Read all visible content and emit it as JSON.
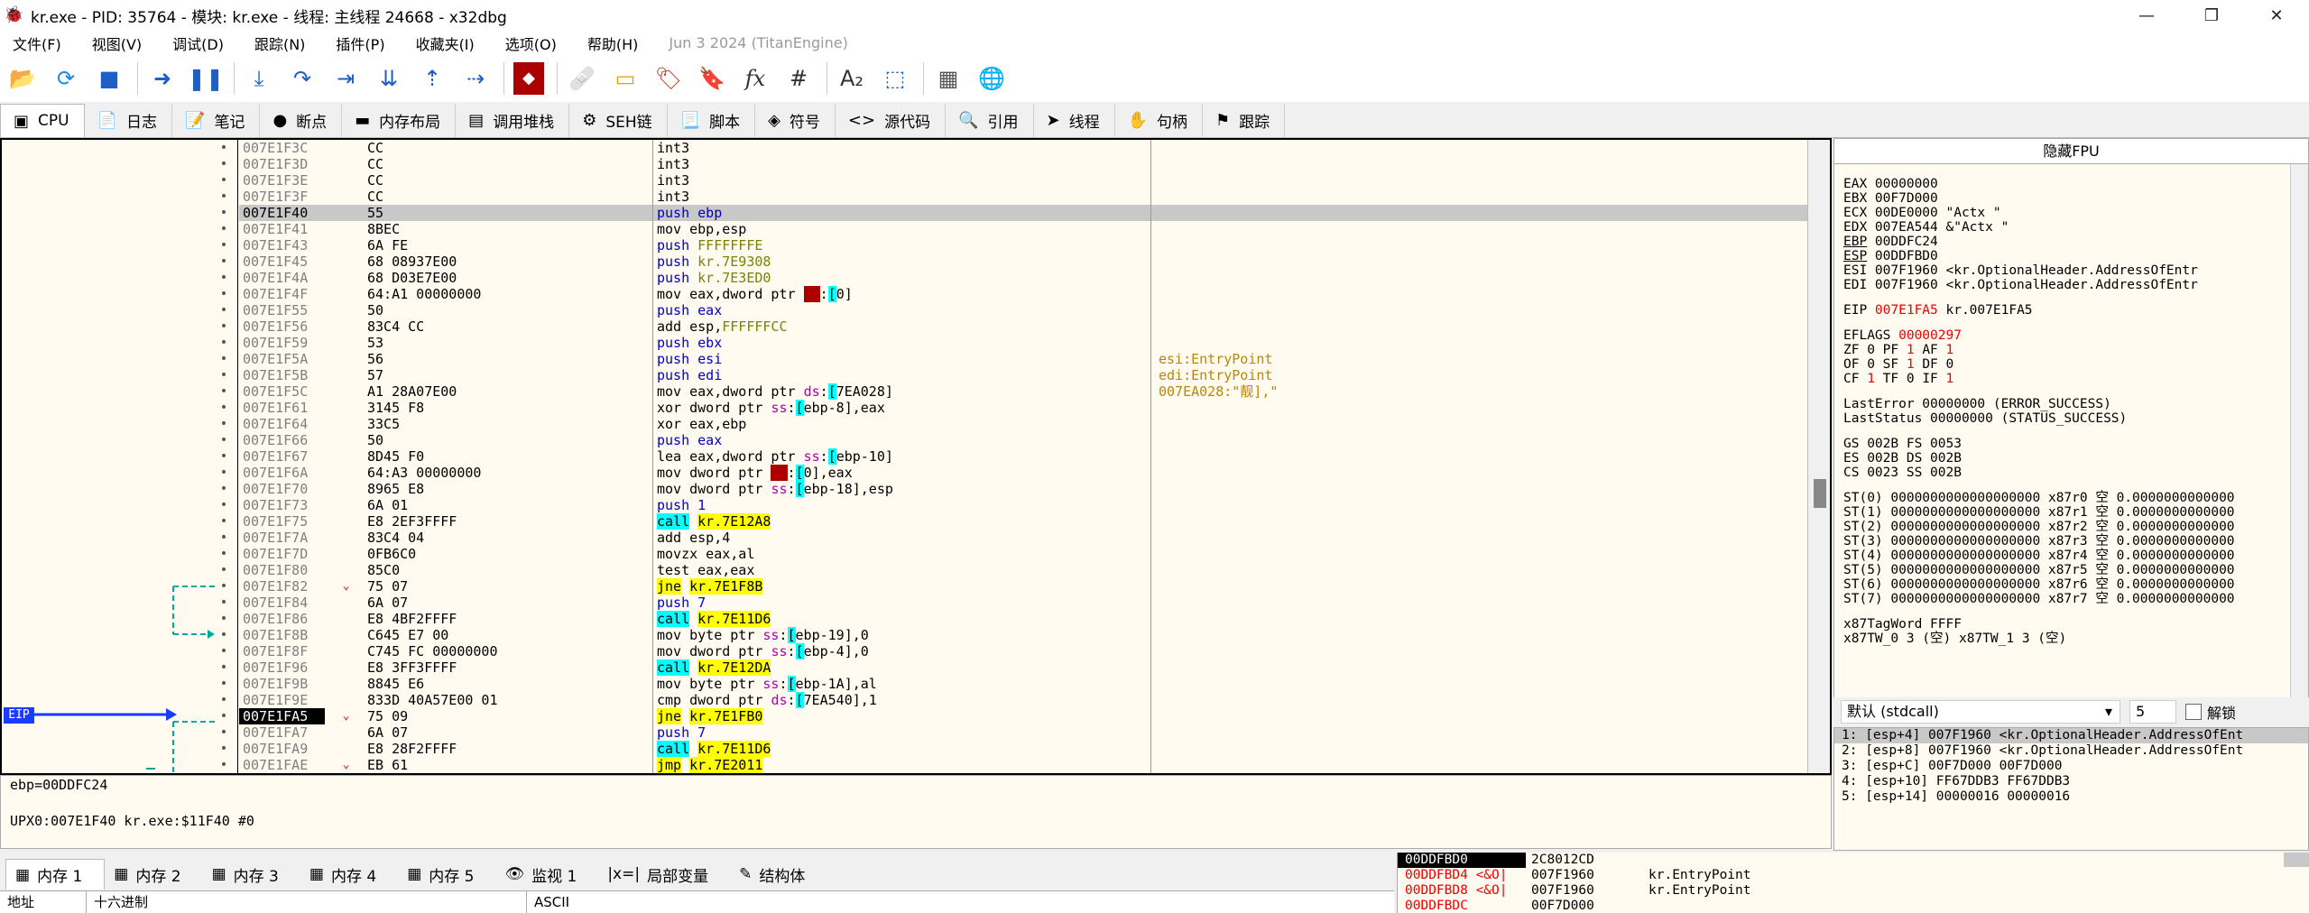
{
  "window": {
    "title": "kr.exe - PID: 35764 - 模块: kr.exe - 线程: 主线程 24668 - x32dbg",
    "min": "—",
    "max": "❐",
    "close": "✕"
  },
  "menu": [
    "文件(F)",
    "视图(V)",
    "调试(D)",
    "跟踪(N)",
    "插件(P)",
    "收藏夹(I)",
    "选项(O)",
    "帮助(H)"
  ],
  "menu_date": "Jun 3 2024 (TitanEngine)",
  "toolbar_icons": [
    "open-folder-icon",
    "restart-icon",
    "stop-icon",
    "run-icon",
    "pause-icon",
    "step-into-icon",
    "step-over-icon",
    "trace-into-icon",
    "trace-over-icon",
    "execute-till-return-icon",
    "run-to-user-code-icon",
    "script-icon",
    "patch-icon",
    "comment-icon",
    "label-icon",
    "bookmark-icon",
    "function-icon",
    "hash-icon",
    "font-icon",
    "scylla-icon",
    "calculator-icon",
    "globe-icon"
  ],
  "toolbar_glyphs": [
    "📂",
    "⟳",
    "■",
    "➜",
    "❚❚",
    "⤓",
    "↷",
    "⇥",
    "⇊",
    "⇡",
    "⇢",
    "◆",
    "🩹",
    "▭",
    "🏷",
    "🔖",
    "fx",
    "#",
    "A₂",
    "⬚",
    "▦",
    "🌐"
  ],
  "tabs": [
    {
      "icon": "▣",
      "label": "CPU"
    },
    {
      "icon": "📄",
      "label": "日志"
    },
    {
      "icon": "📝",
      "label": "笔记"
    },
    {
      "icon": "●",
      "label": "断点"
    },
    {
      "icon": "▬",
      "label": "内存布局"
    },
    {
      "icon": "▤",
      "label": "调用堆栈"
    },
    {
      "icon": "⚙",
      "label": "SEH链"
    },
    {
      "icon": "📃",
      "label": "脚本"
    },
    {
      "icon": "◈",
      "label": "符号"
    },
    {
      "icon": "<>",
      "label": "源代码"
    },
    {
      "icon": "🔍",
      "label": "引用"
    },
    {
      "icon": "➤",
      "label": "线程"
    },
    {
      "icon": "✋",
      "label": "句柄"
    },
    {
      "icon": "⚑",
      "label": "跟踪"
    }
  ],
  "eip_label": "EIP",
  "disasm": [
    {
      "addr": "007E1F3C",
      "arr": "",
      "bytes": "CC",
      "asm": "int3",
      "cls": "kw-int3",
      "cmt": ""
    },
    {
      "addr": "007E1F3D",
      "arr": "",
      "bytes": "CC",
      "asm": "int3",
      "cls": "kw-int3",
      "cmt": ""
    },
    {
      "addr": "007E1F3E",
      "arr": "",
      "bytes": "CC",
      "asm": "int3",
      "cls": "kw-int3",
      "cmt": ""
    },
    {
      "addr": "007E1F3F",
      "arr": "",
      "bytes": "CC",
      "asm": "int3",
      "cls": "kw-int3",
      "cmt": ""
    },
    {
      "addr": "007E1F40",
      "arr": "",
      "bytes": "55",
      "asm": "push ebp",
      "cls": "kw-push",
      "cmt": "",
      "cur": true
    },
    {
      "addr": "007E1F41",
      "arr": "",
      "bytes": "8BEC",
      "asm": "mov ebp,esp",
      "cls": "kw-mov",
      "cmt": ""
    },
    {
      "addr": "007E1F43",
      "arr": "",
      "bytes": "6A FE",
      "asm": "push FFFFFFFE",
      "cls": "kw-push",
      "cmt": ""
    },
    {
      "addr": "007E1F45",
      "arr": "",
      "bytes": "68 08937E00",
      "asm": "push kr.7E9308",
      "cls": "kw-push",
      "cmt": ""
    },
    {
      "addr": "007E1F4A",
      "arr": "",
      "bytes": "68 D03E7E00",
      "asm": "push kr.7E3ED0",
      "cls": "kw-push",
      "cmt": ""
    },
    {
      "addr": "007E1F4F",
      "arr": "",
      "bytes": "64:A1 00000000",
      "asm": "mov eax,dword ptr fs:[0]",
      "cls": "kw-mov",
      "cmt": ""
    },
    {
      "addr": "007E1F55",
      "arr": "",
      "bytes": "50",
      "asm": "push eax",
      "cls": "kw-push",
      "cmt": ""
    },
    {
      "addr": "007E1F56",
      "arr": "",
      "bytes": "83C4 CC",
      "asm": "add esp,FFFFFFCC",
      "cls": "kw-mov",
      "cmt": ""
    },
    {
      "addr": "007E1F59",
      "arr": "",
      "bytes": "53",
      "asm": "push ebx",
      "cls": "kw-push",
      "cmt": ""
    },
    {
      "addr": "007E1F5A",
      "arr": "",
      "bytes": "56",
      "asm": "push esi",
      "cls": "kw-push",
      "cmt": "esi:EntryPoint"
    },
    {
      "addr": "007E1F5B",
      "arr": "",
      "bytes": "57",
      "asm": "push edi",
      "cls": "kw-push",
      "cmt": "edi:EntryPoint"
    },
    {
      "addr": "007E1F5C",
      "arr": "",
      "bytes": "A1 28A07E00",
      "asm": "mov eax,dword ptr ds:[7EA028]",
      "cls": "kw-mov",
      "cmt": "007EA028:\"靓],\""
    },
    {
      "addr": "007E1F61",
      "arr": "",
      "bytes": "3145 F8",
      "asm": "xor dword ptr ss:[ebp-8],eax",
      "cls": "kw-mov",
      "cmt": ""
    },
    {
      "addr": "007E1F64",
      "arr": "",
      "bytes": "33C5",
      "asm": "xor eax,ebp",
      "cls": "kw-mov",
      "cmt": ""
    },
    {
      "addr": "007E1F66",
      "arr": "",
      "bytes": "50",
      "asm": "push eax",
      "cls": "kw-push",
      "cmt": ""
    },
    {
      "addr": "007E1F67",
      "arr": "",
      "bytes": "8D45 F0",
      "asm": "lea eax,dword ptr ss:[ebp-10]",
      "cls": "kw-mov",
      "cmt": ""
    },
    {
      "addr": "007E1F6A",
      "arr": "",
      "bytes": "64:A3 00000000",
      "asm": "mov dword ptr fs:[0],eax",
      "cls": "kw-mov",
      "cmt": ""
    },
    {
      "addr": "007E1F70",
      "arr": "",
      "bytes": "8965 E8",
      "asm": "mov dword ptr ss:[ebp-18],esp",
      "cls": "kw-mov",
      "cmt": ""
    },
    {
      "addr": "007E1F73",
      "arr": "",
      "bytes": "6A 01",
      "asm": "push 1",
      "cls": "kw-push",
      "cmt": ""
    },
    {
      "addr": "007E1F75",
      "arr": "",
      "bytes": "E8 2EF3FFFF",
      "asm": "call kr.7E12A8",
      "cls": "kw-call",
      "cmt": ""
    },
    {
      "addr": "007E1F7A",
      "arr": "",
      "bytes": "83C4 04",
      "asm": "add esp,4",
      "cls": "kw-mov",
      "cmt": ""
    },
    {
      "addr": "007E1F7D",
      "arr": "",
      "bytes": "0FB6C0",
      "asm": "movzx eax,al",
      "cls": "kw-mov",
      "cmt": ""
    },
    {
      "addr": "007E1F80",
      "arr": "",
      "bytes": "85C0",
      "asm": "test eax,eax",
      "cls": "kw-mov",
      "cmt": ""
    },
    {
      "addr": "007E1F82",
      "arr": "⌄",
      "bytes": "75 07",
      "asm": "jne kr.7E1F8B",
      "cls": "kw-jmp",
      "cmt": ""
    },
    {
      "addr": "007E1F84",
      "arr": "",
      "bytes": "6A 07",
      "asm": "push 7",
      "cls": "kw-push",
      "cmt": ""
    },
    {
      "addr": "007E1F86",
      "arr": "",
      "bytes": "E8 4BF2FFFF",
      "asm": "call kr.7E11D6",
      "cls": "kw-call",
      "cmt": ""
    },
    {
      "addr": "007E1F8B",
      "arr": "",
      "bytes": "C645 E7 00",
      "asm": "mov byte ptr ss:[ebp-19],0",
      "cls": "kw-mov",
      "cmt": ""
    },
    {
      "addr": "007E1F8F",
      "arr": "",
      "bytes": "C745 FC 00000000",
      "asm": "mov dword ptr ss:[ebp-4],0",
      "cls": "kw-mov",
      "cmt": ""
    },
    {
      "addr": "007E1F96",
      "arr": "",
      "bytes": "E8 3FF3FFFF",
      "asm": "call kr.7E12DA",
      "cls": "kw-call",
      "cmt": ""
    },
    {
      "addr": "007E1F9B",
      "arr": "",
      "bytes": "8845 E6",
      "asm": "mov byte ptr ss:[ebp-1A],al",
      "cls": "kw-mov",
      "cmt": ""
    },
    {
      "addr": "007E1F9E",
      "arr": "",
      "bytes": "833D 40A57E00 01",
      "asm": "cmp dword ptr ds:[7EA540],1",
      "cls": "kw-mov",
      "cmt": ""
    },
    {
      "addr": "007E1FA5",
      "arr": "⌄",
      "bytes": "75 09",
      "asm": "jne kr.7E1FB0",
      "cls": "kw-jmp",
      "cmt": "",
      "eip": true
    },
    {
      "addr": "007E1FA7",
      "arr": "",
      "bytes": "6A 07",
      "asm": "push 7",
      "cls": "kw-push",
      "cmt": ""
    },
    {
      "addr": "007E1FA9",
      "arr": "",
      "bytes": "E8 28F2FFFF",
      "asm": "call kr.7E11D6",
      "cls": "kw-call",
      "cmt": ""
    },
    {
      "addr": "007E1FAE",
      "arr": "⌄",
      "bytes": "EB 61",
      "asm": "jmp kr.7E2011",
      "cls": "kw-jmp",
      "cmt": ""
    }
  ],
  "info_lines": [
    "ebp=00DDFC24",
    "",
    "UPX0:007E1F40 kr.exe:$11F40 #0"
  ],
  "regs_header": "隐藏FPU",
  "regs": [
    "EAX    00000000",
    "EBX    00F7D000",
    "ECX    00DE0000     \"Actx \"",
    "EDX    007EA544     &\"Actx \"",
    "EBP    00DDFC24",
    "ESP    00DDFBD0",
    "ESI    007F1960     <kr.OptionalHeader.AddressOfEntr",
    "EDI    007F1960     <kr.OptionalHeader.AddressOfEntr",
    "",
    "EIP    007E1FA5     kr.007E1FA5",
    "",
    "EFLAGS    00000297",
    "ZF 0  PF 1  AF 1",
    "OF 0  SF 1  DF 0",
    "CF 1  TF 0  IF 1",
    "",
    "LastError  00000000 (ERROR_SUCCESS)",
    "LastStatus 00000000 (STATUS_SUCCESS)",
    "",
    "GS 002B  FS 0053",
    "ES 002B  DS 002B",
    "CS 0023  SS 002B",
    "",
    "ST(0) 0000000000000000000 x87r0 空 0.0000000000000",
    "ST(1) 0000000000000000000 x87r1 空 0.0000000000000",
    "ST(2) 0000000000000000000 x87r2 空 0.0000000000000",
    "ST(3) 0000000000000000000 x87r3 空 0.0000000000000",
    "ST(4) 0000000000000000000 x87r4 空 0.0000000000000",
    "ST(5) 0000000000000000000 x87r5 空 0.0000000000000",
    "ST(6) 0000000000000000000 x87r6 空 0.0000000000000",
    "ST(7) 0000000000000000000 x87r7 空 0.0000000000000",
    "",
    "x87TagWord  FFFF",
    "x87TW_0 3 (空)      x87TW_1 3 (空)"
  ],
  "callconv": {
    "value": "默认 (stdcall)",
    "arrow": "▾",
    "count": "5",
    "unlock": "解锁"
  },
  "stack_args": [
    "1: [esp+4] 007F1960 <kr.OptionalHeader.AddressOfEnt",
    "2: [esp+8] 007F1960 <kr.OptionalHeader.AddressOfEnt",
    "3: [esp+C] 00F7D000 00F7D000",
    "4: [esp+10] FF67DDB3 FF67DDB3",
    "5: [esp+14] 00000016 00000016"
  ],
  "bottom_tabs": [
    {
      "icon": "▦",
      "label": "内存 1"
    },
    {
      "icon": "▦",
      "label": "内存 2"
    },
    {
      "icon": "▦",
      "label": "内存 3"
    },
    {
      "icon": "▦",
      "label": "内存 4"
    },
    {
      "icon": "▦",
      "label": "内存 5"
    },
    {
      "icon": "👁",
      "label": "监视 1"
    },
    {
      "icon": "|x=|",
      "label": "局部变量"
    },
    {
      "icon": "✎",
      "label": "结构体"
    }
  ],
  "dump_header": [
    "地址",
    "十六进制",
    "ASCII"
  ],
  "stack": [
    {
      "addr": "00DDFBD0",
      "val": "2C8012CD",
      "cmt": ""
    },
    {
      "addr": "00DDFBD4",
      "val": "007F1960",
      "cmt": "kr.EntryPoint",
      "mark": "<&O|"
    },
    {
      "addr": "00DDFBD8",
      "val": "007F1960",
      "cmt": "kr.EntryPoint",
      "mark": "<&O|"
    },
    {
      "addr": "00DDFBDC",
      "val": "00F7D000",
      "cmt": ""
    }
  ]
}
